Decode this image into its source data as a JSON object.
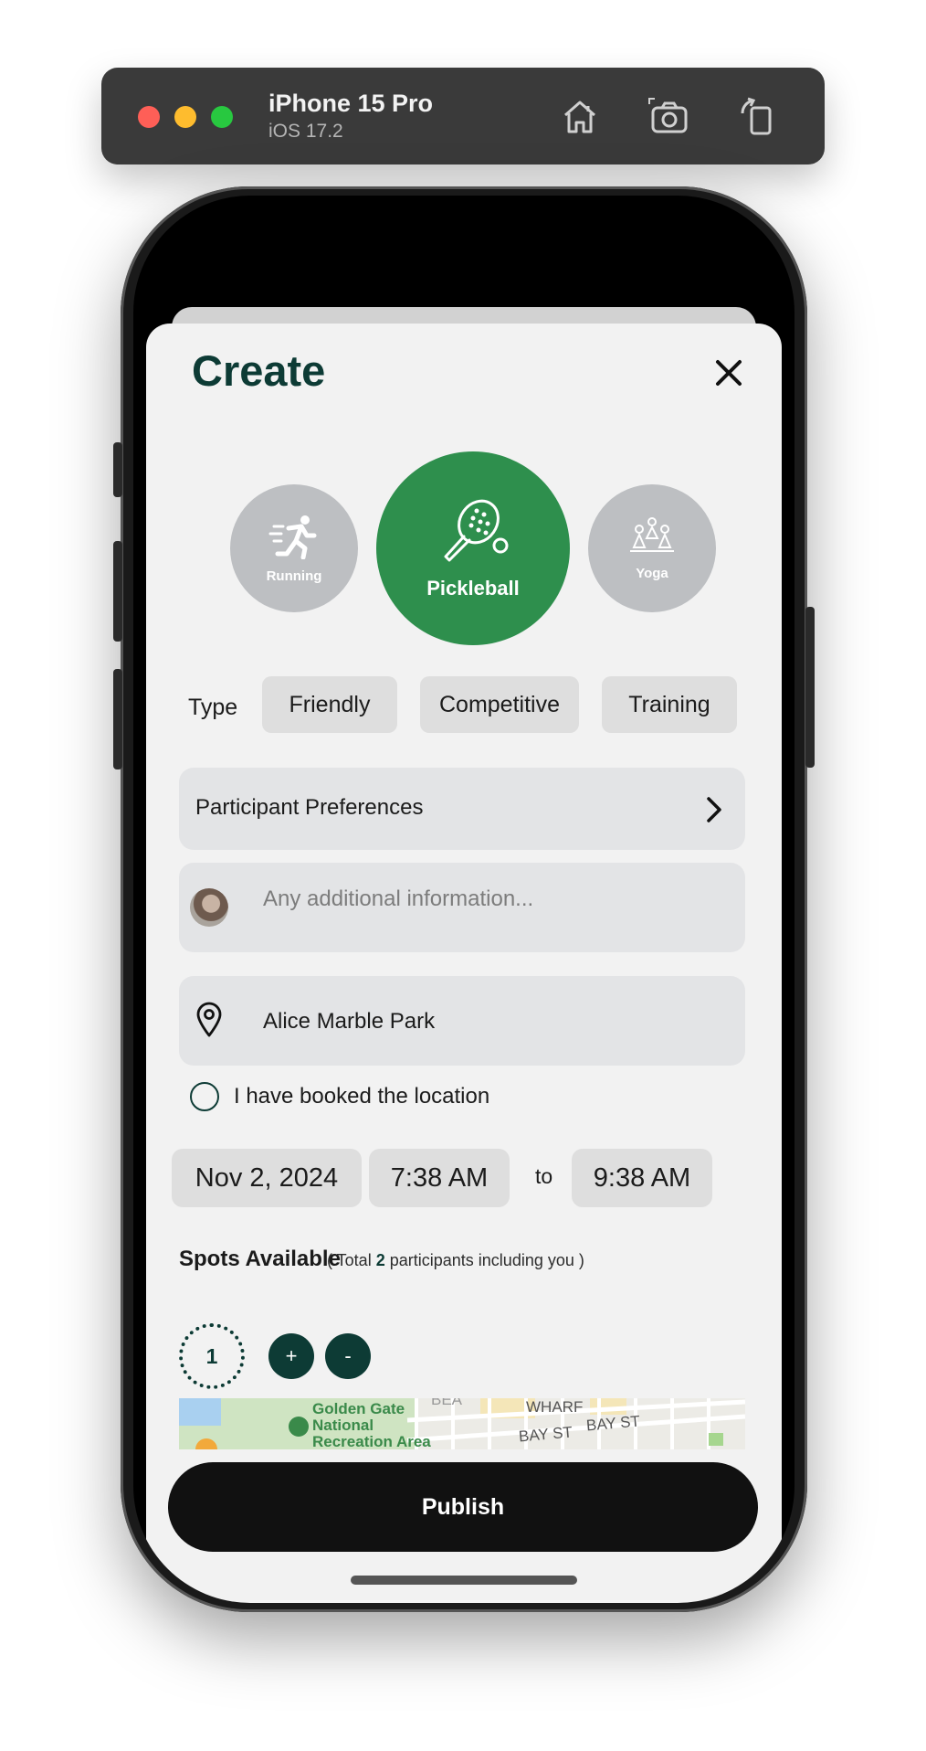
{
  "simulator": {
    "device_name": "iPhone 15 Pro",
    "os_version": "iOS 17.2",
    "icons": [
      "home-icon",
      "screenshot-icon",
      "rotate-icon"
    ]
  },
  "sheet": {
    "title": "Create",
    "close_icon": "close-icon"
  },
  "activities": [
    {
      "label": "Running",
      "icon": "running-icon",
      "selected": false
    },
    {
      "label": "Pickleball",
      "icon": "pickleball-icon",
      "selected": true
    },
    {
      "label": "Yoga",
      "icon": "yoga-icon",
      "selected": false
    }
  ],
  "type": {
    "label": "Type",
    "options": [
      "Friendly",
      "Competitive",
      "Training"
    ]
  },
  "participant_preferences": {
    "label": "Participant Preferences",
    "icon": "chevron-right-icon"
  },
  "additional_info": {
    "placeholder": "Any additional information..."
  },
  "location": {
    "value": "Alice Marble Park",
    "icon": "location-pin-icon",
    "booked_label": "I have booked the location",
    "booked": false
  },
  "datetime": {
    "date": "Nov 2, 2024",
    "start": "7:38 AM",
    "separator": "to",
    "end": "9:38 AM"
  },
  "spots": {
    "label": "Spots Available",
    "note_prefix": "( Total",
    "total": "2",
    "note_suffix": "participants including you )",
    "count": "1",
    "plus": "+",
    "minus": "-"
  },
  "map": {
    "labels": [
      "Golden Gate",
      "National",
      "Recreation Area",
      "WHARF",
      "BAY ST",
      "BAY ST",
      "BEA"
    ],
    "colors": {
      "park": "#cfe4c2",
      "water": "#a9d0f0",
      "road": "#ffffff",
      "label_park": "#3a8a4a",
      "label_street": "#555555"
    }
  },
  "publish": {
    "label": "Publish"
  },
  "colors": {
    "brand_dark": "#0d3b35",
    "selected_activity": "#2e8f4d",
    "unselected_activity": "#bdbfc2",
    "publish_bg": "#111111"
  }
}
